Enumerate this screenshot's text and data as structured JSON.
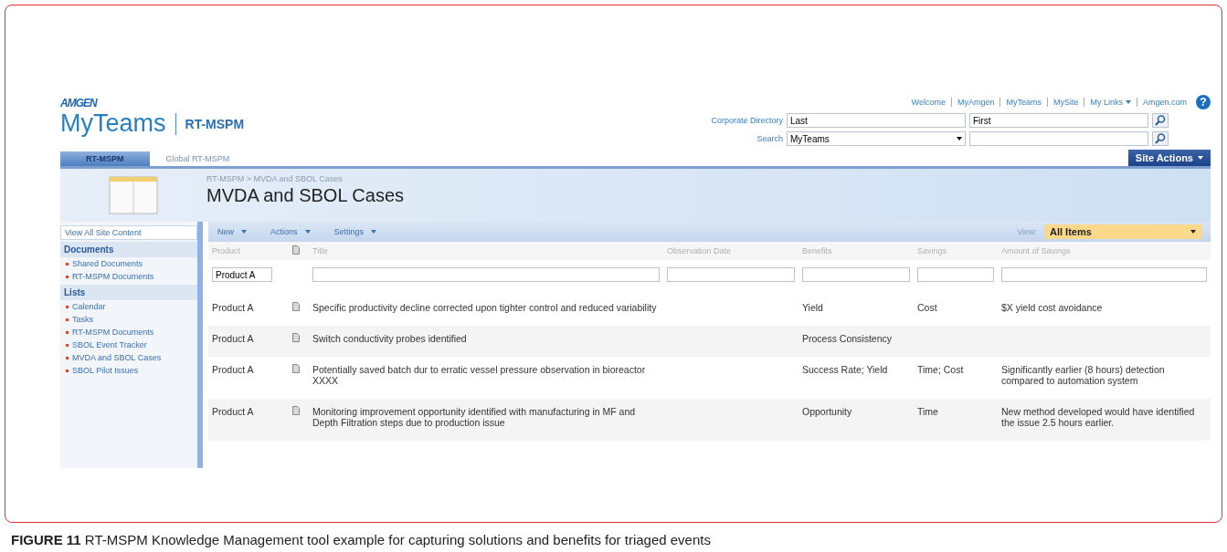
{
  "logo": "AMGEN",
  "site_title": "MyTeams",
  "site_subtitle": "RT-MSPM",
  "top_links": [
    {
      "label": "Welcome",
      "dropdown": false
    },
    {
      "label": "MyAmgen",
      "dropdown": false
    },
    {
      "label": "MyTeams",
      "dropdown": false
    },
    {
      "label": "MySite",
      "dropdown": false
    },
    {
      "label": "My Links",
      "dropdown": true
    },
    {
      "label": "Amgen.com",
      "dropdown": false
    }
  ],
  "help": "?",
  "corporate_directory": {
    "label": "Corporate Directory",
    "last": "Last",
    "first": "First"
  },
  "search": {
    "label": "Search",
    "scope": "MyTeams"
  },
  "tabs": [
    {
      "label": "RT-MSPM",
      "selected": true
    },
    {
      "label": "Global RT-MSPM",
      "selected": false
    }
  ],
  "site_actions": "Site Actions",
  "breadcrumb": "RT-MSPM > MVDA and SBOL Cases",
  "page_title": "MVDA and SBOL Cases",
  "sidebar": {
    "view_all": "View All Site Content",
    "sections": [
      {
        "heading": "Documents",
        "items": [
          "Shared Documents",
          "RT-MSPM Documents"
        ]
      },
      {
        "heading": "Lists",
        "items": [
          "Calendar",
          "Tasks",
          "RT-MSPM Documents",
          "SBOL Event Tracker",
          "MVDA and SBOL Cases",
          "SBOL Pilot Issues"
        ]
      }
    ]
  },
  "toolbar": {
    "menus": [
      "New",
      "Actions",
      "Settings"
    ],
    "view_label": "View:",
    "view": "All Items"
  },
  "table": {
    "columns": [
      "Product",
      null,
      "Title",
      "Observation Date",
      "Benefits",
      "Savings",
      "Amount of Savings"
    ],
    "filters": {
      "product": "Product A"
    },
    "rows": [
      {
        "product": "Product A",
        "title": "Specific productivity decline corrected upon tighter control and reduced variability",
        "benefits": "Yield",
        "savings": "Cost",
        "amount": "$X yield cost avoidance"
      },
      {
        "product": "Product A",
        "title": "Switch conductivity probes identified",
        "benefits": "Process Consistency"
      },
      {
        "product": "Product A",
        "title": "Potentially saved batch dur to erratic vessel pressure observation in bioreactor XXXX",
        "benefits": "Success Rate; Yield",
        "savings": "Time; Cost",
        "amount": "Significantly earlier (8 hours) detection compared to automation system"
      },
      {
        "product": "Product A",
        "title": "Monitoring improvement opportunity identified with manufacturing in MF and Depth Filtration steps due to production issue",
        "benefits": "Opportunity",
        "savings": "Time",
        "amount": "New method developed would have identified the issue 2.5 hours earlier."
      }
    ]
  },
  "caption": "**FIGURE 11** RT-MSPM Knowledge Management tool example for capturing solutions and benefits for triaged events"
}
